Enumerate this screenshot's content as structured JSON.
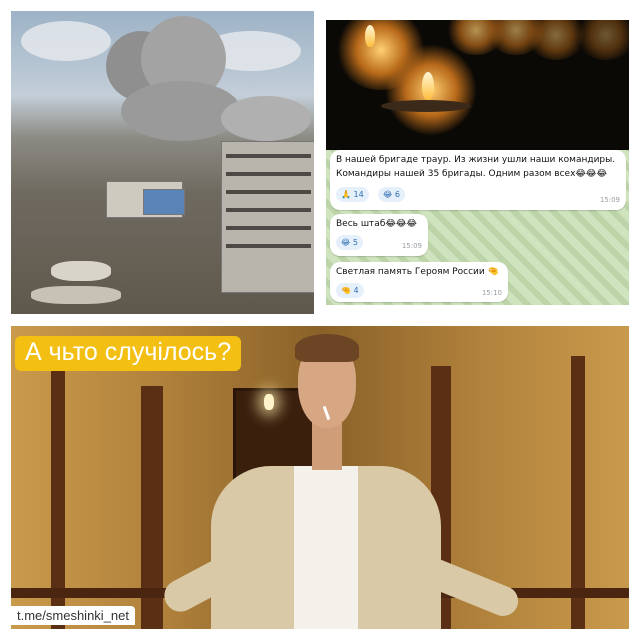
{
  "chat": {
    "messages": [
      {
        "lines": [
          "В нашей бригаде траур. Из жизни ушли наши командиры.",
          "Командиры нашей 35 бригады. Одним разом всех😂😂😂"
        ],
        "reactions": [
          {
            "emoji": "🙏",
            "count": "14"
          },
          {
            "emoji": "😂",
            "count": "6"
          }
        ],
        "time": "15:09"
      },
      {
        "lines": [
          "Весь штаб😂😂😂"
        ],
        "reactions": [
          {
            "emoji": "😂",
            "count": "5"
          }
        ],
        "time": "15:09"
      },
      {
        "lines": [
          "Светлая память Героям России 🤏"
        ],
        "reactions": [
          {
            "emoji": "🤏",
            "count": "4"
          }
        ],
        "time": "15:10"
      }
    ]
  },
  "meme": {
    "caption": "А чьто случілось?",
    "watermark": "t.me/smeshinki_net"
  }
}
